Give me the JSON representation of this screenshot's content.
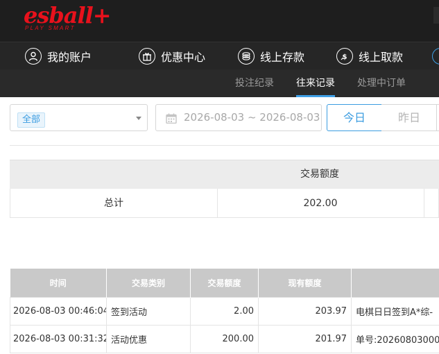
{
  "logo": {
    "main": "esball+",
    "sub": "PLAY SMART"
  },
  "nav": {
    "items": [
      {
        "label": "我的账户",
        "icon": "user-icon"
      },
      {
        "label": "优惠中心",
        "icon": "gift-icon"
      },
      {
        "label": "线上存款",
        "icon": "deposit-icon"
      },
      {
        "label": "线上取款",
        "icon": "withdraw-icon"
      }
    ]
  },
  "subnav": {
    "tabs": [
      {
        "label": "投注纪录",
        "active": false
      },
      {
        "label": "往来记录",
        "active": true
      },
      {
        "label": "处理中订单",
        "active": false
      }
    ]
  },
  "filter": {
    "category": "全部",
    "date_range": "2026-08-03 ~ 2026-08-03",
    "today": "今日",
    "yesterday": "昨日"
  },
  "summary": {
    "header": "交易额度",
    "row_label": "总计",
    "total": "202.00"
  },
  "detail": {
    "headers": [
      "时间",
      "交易类别",
      "交易额度",
      "现有额度",
      ""
    ],
    "rows": [
      [
        "2026-08-03 00:46:04",
        "签到活动",
        "2.00",
        "203.97",
        "电棋日日签到A*综-"
      ],
      [
        "2026-08-03 00:31:32",
        "活动优惠",
        "200.00",
        "201.97",
        "单号:20260803000"
      ]
    ]
  },
  "colors": {
    "brand": "#e8111c",
    "accent": "#3fa0e6",
    "header_bg": "#1e1e1e"
  }
}
